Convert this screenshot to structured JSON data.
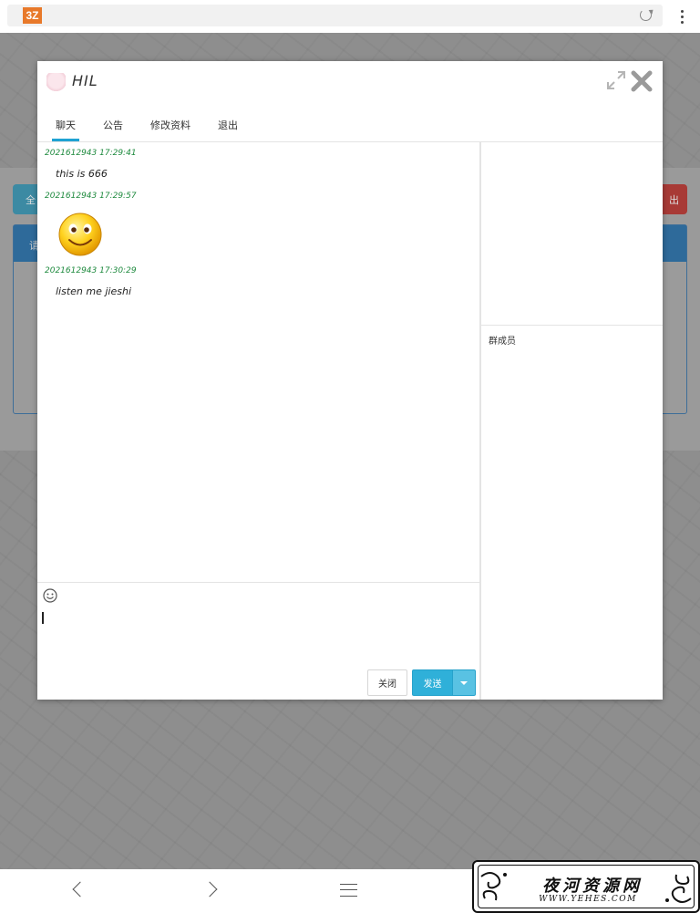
{
  "browser": {
    "logo_text": "3Z"
  },
  "background_page": {
    "left_button_text": "全",
    "right_button_text": "出",
    "panel_header_text": "请"
  },
  "modal": {
    "title": "HIL",
    "tabs": [
      {
        "label": "聊天",
        "active": true
      },
      {
        "label": "公告",
        "active": false
      },
      {
        "label": "修改资料",
        "active": false
      },
      {
        "label": "退出",
        "active": false
      }
    ],
    "messages": [
      {
        "time": "2021612943 17:29:41",
        "text": "this is 666"
      },
      {
        "time": "2021612943 17:29:57",
        "emoji": "smiley-face"
      },
      {
        "time": "2021612943 17:30:29",
        "text": "listen me jieshi"
      }
    ],
    "members_label": "群成员",
    "input_value": "",
    "buttons": {
      "close_label": "关闭",
      "send_label": "发送"
    },
    "colors": {
      "accent": "#1fa2d3",
      "send_button": "#2fb0d9",
      "timestamp": "#1e8a3e"
    }
  },
  "watermark": {
    "title": "夜河资源网",
    "url": "WWW.YEHES.COM"
  }
}
